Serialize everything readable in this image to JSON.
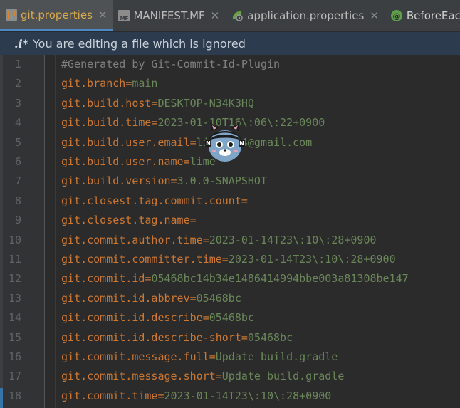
{
  "tabs": [
    {
      "label": "git.properties",
      "icon": "properties-file-icon",
      "active": true,
      "closable": true
    },
    {
      "label": "MANIFEST.MF",
      "icon": "manifest-file-icon",
      "active": false,
      "closable": true
    },
    {
      "label": "application.properties",
      "icon": "spring-properties-icon",
      "active": false,
      "closable": true
    },
    {
      "label": "BeforeEach.c",
      "icon": "annotation-file-icon",
      "active": false,
      "closable": false
    }
  ],
  "tab_close_glyph": "✕",
  "banner": {
    "icon_text": ".i*",
    "message": "You are editing a file which is ignored"
  },
  "editor": {
    "lines": [
      {
        "num": "1",
        "text": "#Generated by Git-Commit-Id-Plugin"
      },
      {
        "num": "2",
        "key": "git.branch",
        "value": "main"
      },
      {
        "num": "3",
        "key": "git.build.host",
        "value": "DESKTOP-N34K3HQ"
      },
      {
        "num": "4",
        "key": "git.build.time",
        "value": "2023-01-10T16\\:06\\:22+0900"
      },
      {
        "num": "5",
        "key": "git.build.user.email",
        "value": "lime1234@gmail.com"
      },
      {
        "num": "6",
        "key": "git.build.user.name",
        "value": "lime"
      },
      {
        "num": "7",
        "key": "git.build.version",
        "value": "3.0.0-SNAPSHOT"
      },
      {
        "num": "8",
        "key": "git.closest.tag.commit.count",
        "value": ""
      },
      {
        "num": "9",
        "key": "git.closest.tag.name",
        "value": ""
      },
      {
        "num": "10",
        "key": "git.commit.author.time",
        "value": "2023-01-14T23\\:10\\:28+0900"
      },
      {
        "num": "11",
        "key": "git.commit.committer.time",
        "value": "2023-01-14T23\\:10\\:28+0900"
      },
      {
        "num": "12",
        "key": "git.commit.id",
        "value": "05468bc14b34e1486414994bbe003a81308be147"
      },
      {
        "num": "13",
        "key": "git.commit.id.abbrev",
        "value": "05468bc"
      },
      {
        "num": "14",
        "key": "git.commit.id.describe",
        "value": "05468bc"
      },
      {
        "num": "15",
        "key": "git.commit.id.describe-short",
        "value": "05468bc"
      },
      {
        "num": "16",
        "key": "git.commit.message.full",
        "value": "Update build.gradle"
      },
      {
        "num": "17",
        "key": "git.commit.message.short",
        "value": "Update build.gradle"
      },
      {
        "num": "18",
        "key": "git.commit.time",
        "value": "2023-01-14T23\\:10\\:28+0900"
      }
    ]
  },
  "overlay": {
    "icon": "cat-avatar-icon"
  },
  "colors": {
    "editor_bg": "#2b2b2b",
    "key": "#cc7832",
    "value": "#6a8759",
    "comment": "#808080",
    "line_number": "#606366",
    "active_tab_text": "#d9a94d",
    "banner_bg": "#2d3b4e"
  }
}
